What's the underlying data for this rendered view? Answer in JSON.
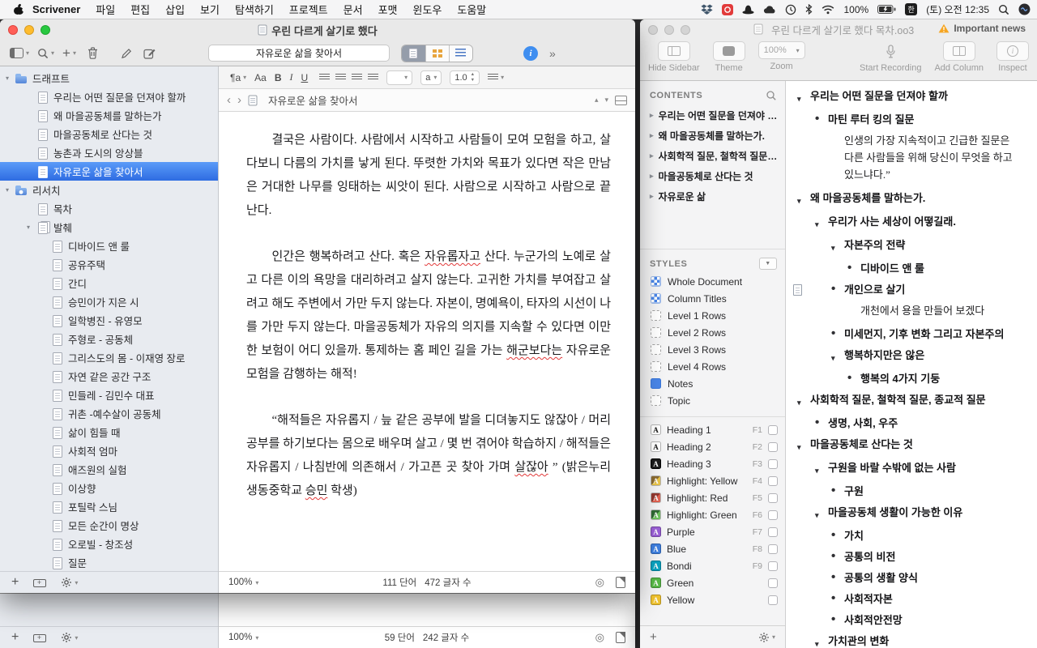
{
  "menu_bar": {
    "app_name": "Scrivener",
    "menus": [
      "파일",
      "편집",
      "삽입",
      "보기",
      "탐색하기",
      "프로젝트",
      "문서",
      "포맷",
      "윈도우",
      "도움말"
    ],
    "status": {
      "battery": "100%",
      "input_source": "한",
      "clock": "(토) 오전 12:35"
    }
  },
  "scrivener": {
    "window_title": "우린 다르게 살기로 했다",
    "toolbar": {
      "field_value": "자유로운 삶을 찾아서"
    },
    "format_bar": {
      "style": "¶a",
      "font": "Aa",
      "bold": "B",
      "italic": "I",
      "underline": "U",
      "spacing": "1.0",
      "color": "a"
    },
    "binder": {
      "items": [
        {
          "label": "드래프트",
          "icon": "folder",
          "level": 0,
          "disc": "▾"
        },
        {
          "label": "우리는 어떤 질문을 던져야 할까",
          "icon": "page",
          "level": 1
        },
        {
          "label": "왜 마을공동체를 말하는가",
          "icon": "page",
          "level": 1
        },
        {
          "label": "마을공동체로 산다는 것",
          "icon": "page",
          "level": 1
        },
        {
          "label": "농촌과 도시의 앙상블",
          "icon": "page",
          "level": 1
        },
        {
          "label": "자유로운 삶을 찾아서",
          "icon": "page",
          "level": 1,
          "selected": true
        },
        {
          "label": "리서치",
          "icon": "folder-media",
          "level": 0,
          "disc": "▾"
        },
        {
          "label": "목차",
          "icon": "page",
          "level": 1
        },
        {
          "label": "발췌",
          "icon": "stack",
          "level": 1,
          "disc": "▾"
        },
        {
          "label": "디바이드 앤 룰",
          "icon": "page",
          "level": 2
        },
        {
          "label": "공유주택",
          "icon": "page",
          "level": 2
        },
        {
          "label": "간디",
          "icon": "page",
          "level": 2
        },
        {
          "label": "승민이가 지은 시",
          "icon": "page",
          "level": 2
        },
        {
          "label": "일학병진 - 유영모",
          "icon": "page",
          "level": 2
        },
        {
          "label": "주형로 - 공동체",
          "icon": "page",
          "level": 2
        },
        {
          "label": "그리스도의 몸 - 이재영 장로",
          "icon": "page",
          "level": 2
        },
        {
          "label": "자연 같은 공간 구조",
          "icon": "page",
          "level": 2
        },
        {
          "label": "민들레 - 김민수 대표",
          "icon": "page",
          "level": 2
        },
        {
          "label": "귀촌 -예수살이 공동체",
          "icon": "page",
          "level": 2
        },
        {
          "label": "삶이 힘들 때",
          "icon": "page",
          "level": 2
        },
        {
          "label": "사회적 엄마",
          "icon": "page",
          "level": 2
        },
        {
          "label": "애즈원의 실험",
          "icon": "page",
          "level": 2
        },
        {
          "label": "이상향",
          "icon": "page",
          "level": 2
        },
        {
          "label": "포틸락 스님",
          "icon": "page",
          "level": 2
        },
        {
          "label": "모든 순간이 명상",
          "icon": "page",
          "level": 2
        },
        {
          "label": "오로빌 - 창조성",
          "icon": "page",
          "level": 2
        },
        {
          "label": "질문",
          "icon": "page",
          "level": 2
        }
      ]
    },
    "editor": {
      "header_title": "자유로운 삶을 찾아서",
      "paragraphs": [
        {
          "segments": [
            {
              "t": "결국은 사람이다. 사람에서 시작하고 사람들이 모여 모험을 하고, 살다보니 다름의 가치를 낳게 된다. 뚜렷한 가치와 목표가 있다면 작은 만남은 거대한 나무를 잉태하는 씨앗이 된다. 사람으로 시작하고 사람으로 끝난다."
            }
          ]
        },
        {
          "segments": [
            {
              "t": "인간은 행복하려고 산다. 혹은 "
            },
            {
              "t": "자유롭자고",
              "spell": true
            },
            {
              "t": " 산다. 누군가의 노예로 살고 다른 이의 욕망을 대리하려고 살지 않는다. 고귀한 가치를 부여잡고 살려고 해도 주변에서 가만 두지 않는다. 자본이, 명예욕이, 타자의 시선이 나를 가만 두지 않는다. 마을공동체가 자유의 의지를 지속할 수 있다면 이만한 보험이 어디 있을까. 통제하는 홈 페인 길을 가는 "
            },
            {
              "t": "해군보다는",
              "spell": true
            },
            {
              "t": " 자유로운 모험을 감행하는 해적!"
            }
          ]
        },
        {
          "segments": [
            {
              "t": "“해적들은 자유롭지 / 늪 같은 공부에 발을 디뎌놓지도 않잖아 / 머리 공부를 하기보다는 몸으로 배우며 살고 / 몇 번 겪어야 학습하지 / 해적들은 자유롭지 / 나침반에 의존해서 / 가고픈 곳 찾아 가며 "
            },
            {
              "t": "살잖아",
              "spell": true
            },
            {
              "t": "” (밝은누리 생동중학교 "
            },
            {
              "t": "승민",
              "spell": true
            },
            {
              "t": " 학생)"
            }
          ]
        }
      ],
      "footer": {
        "zoom": "100%",
        "words": "111 단어",
        "chars": "472 글자 수"
      }
    },
    "back_window_footer": {
      "zoom": "100%",
      "words": "59 단어",
      "chars": "242 글자 수"
    }
  },
  "outliner": {
    "window_title": "우린 다르게 살기로 했다 목차.oo3",
    "alert_label": "Important news",
    "toolbar": {
      "hide_sidebar": "Hide Sidebar",
      "theme": "Theme",
      "zoom": "Zoom",
      "zoom_value": "100%",
      "start_recording": "Start Recording",
      "add_column": "Add Column",
      "inspect": "Inspect"
    },
    "sidebar": {
      "contents_title": "CONTENTS",
      "contents_items": [
        {
          "label": "우리는 어떤 질문을 던져야 할까"
        },
        {
          "label": "왜 마을공동체를 말하는가."
        },
        {
          "label": "사회학적 질문, 철학적 질문, …"
        },
        {
          "label": "마을공동체로 산다는 것"
        },
        {
          "label": "자유로운 삶"
        }
      ],
      "styles_title": "STYLES",
      "style_items": [
        {
          "label": "Whole Document",
          "swatch": "grid"
        },
        {
          "label": "Column Titles",
          "swatch": "grid"
        },
        {
          "label": "Level 1 Rows",
          "swatch": "dashed"
        },
        {
          "label": "Level 2 Rows",
          "swatch": "dashed"
        },
        {
          "label": "Level 3 Rows",
          "swatch": "dashed"
        },
        {
          "label": "Level 4 Rows",
          "swatch": "dashed"
        },
        {
          "label": "Notes",
          "swatch": "solid"
        },
        {
          "label": "Topic",
          "swatch": "dashed"
        }
      ],
      "named_styles": [
        {
          "label": "Heading 1",
          "key": "F1",
          "chip": "letter",
          "chip_label": "A"
        },
        {
          "label": "Heading 2",
          "key": "F2",
          "chip": "letter",
          "chip_label": "A"
        },
        {
          "label": "Heading 3",
          "key": "F3",
          "chip": "letter-dark",
          "chip_label": "A"
        },
        {
          "label": "Highlight: Yellow",
          "key": "F4",
          "chip": "hl-yellow",
          "chip_label": "A"
        },
        {
          "label": "Highlight: Red",
          "key": "F5",
          "chip": "hl-red",
          "chip_label": "A"
        },
        {
          "label": "Highlight: Green",
          "key": "F6",
          "chip": "hl-green",
          "chip_label": "A"
        },
        {
          "label": "Purple",
          "key": "F7",
          "chip": "solid",
          "color": "#9a5fd6",
          "chip_label": "A"
        },
        {
          "label": "Blue",
          "key": "F8",
          "chip": "solid",
          "color": "#3e7fe0",
          "chip_label": "A"
        },
        {
          "label": "Bondi",
          "key": "F9",
          "chip": "solid",
          "color": "#0aa2c0",
          "chip_label": "A"
        },
        {
          "label": "Green",
          "key": "",
          "chip": "solid",
          "color": "#58b947",
          "chip_label": "A"
        },
        {
          "label": "Yellow",
          "key": "",
          "chip": "solid",
          "color": "#f0c330",
          "chip_label": "A"
        }
      ]
    },
    "outline": {
      "rows": [
        {
          "text": "우리는 어떤 질문을 던져야 할까",
          "level": 0,
          "marker": "▾"
        },
        {
          "text": "마틴 루터 킹의 질문",
          "level": 1,
          "marker": "•"
        },
        {
          "text": "인생의 가장 지속적이고 긴급한 질문은 다른 사람들을 위해 당신이 무엇을 하고 있느냐다.”",
          "level": 2,
          "kind": "note"
        },
        {
          "text": "왜 마을공동체를 말하는가.",
          "level": 0,
          "marker": "▾"
        },
        {
          "text": "우리가 사는 세상이 어떻길래.",
          "level": 1,
          "marker": "▾"
        },
        {
          "text": "자본주의 전략",
          "level": 2,
          "marker": "▾"
        },
        {
          "text": "디바이드 앤 룰",
          "level": 3,
          "marker": "•"
        },
        {
          "text": "개인으로 살기",
          "level": 2,
          "marker": "•",
          "gutter": true
        },
        {
          "text": "개천에서 용을 만들어 보겠다",
          "level": 3,
          "kind": "note"
        },
        {
          "text": "미세먼지, 기후 변화 그리고 자본주의",
          "level": 2,
          "marker": "•"
        },
        {
          "text": "행복하지만은 않은",
          "level": 2,
          "marker": "▾"
        },
        {
          "text": "행복의 4가지 기둥",
          "level": 3,
          "marker": "•"
        },
        {
          "text": "사회학적 질문, 철학적 질문, 종교적 질문",
          "level": 0,
          "marker": "▾"
        },
        {
          "text": "생명, 사회, 우주",
          "level": 1,
          "marker": "•"
        },
        {
          "text": "마을공동체로 산다는 것",
          "level": 0,
          "marker": "▾"
        },
        {
          "text": "구원을 바랄 수밖에 없는 사람",
          "level": 1,
          "marker": "▾"
        },
        {
          "text": "구원",
          "level": 2,
          "marker": "•"
        },
        {
          "text": "마을공동체 생활이 가능한 이유",
          "level": 1,
          "marker": "▾"
        },
        {
          "text": "가치",
          "level": 2,
          "marker": "•"
        },
        {
          "text": "공통의 비전",
          "level": 2,
          "marker": "•"
        },
        {
          "text": "공통의 생활 양식",
          "level": 2,
          "marker": "•"
        },
        {
          "text": "사회적자본",
          "level": 2,
          "marker": "•"
        },
        {
          "text": "사회적안전망",
          "level": 2,
          "marker": "•"
        },
        {
          "text": "가치관의 변화",
          "level": 1,
          "marker": "▾"
        }
      ]
    }
  }
}
